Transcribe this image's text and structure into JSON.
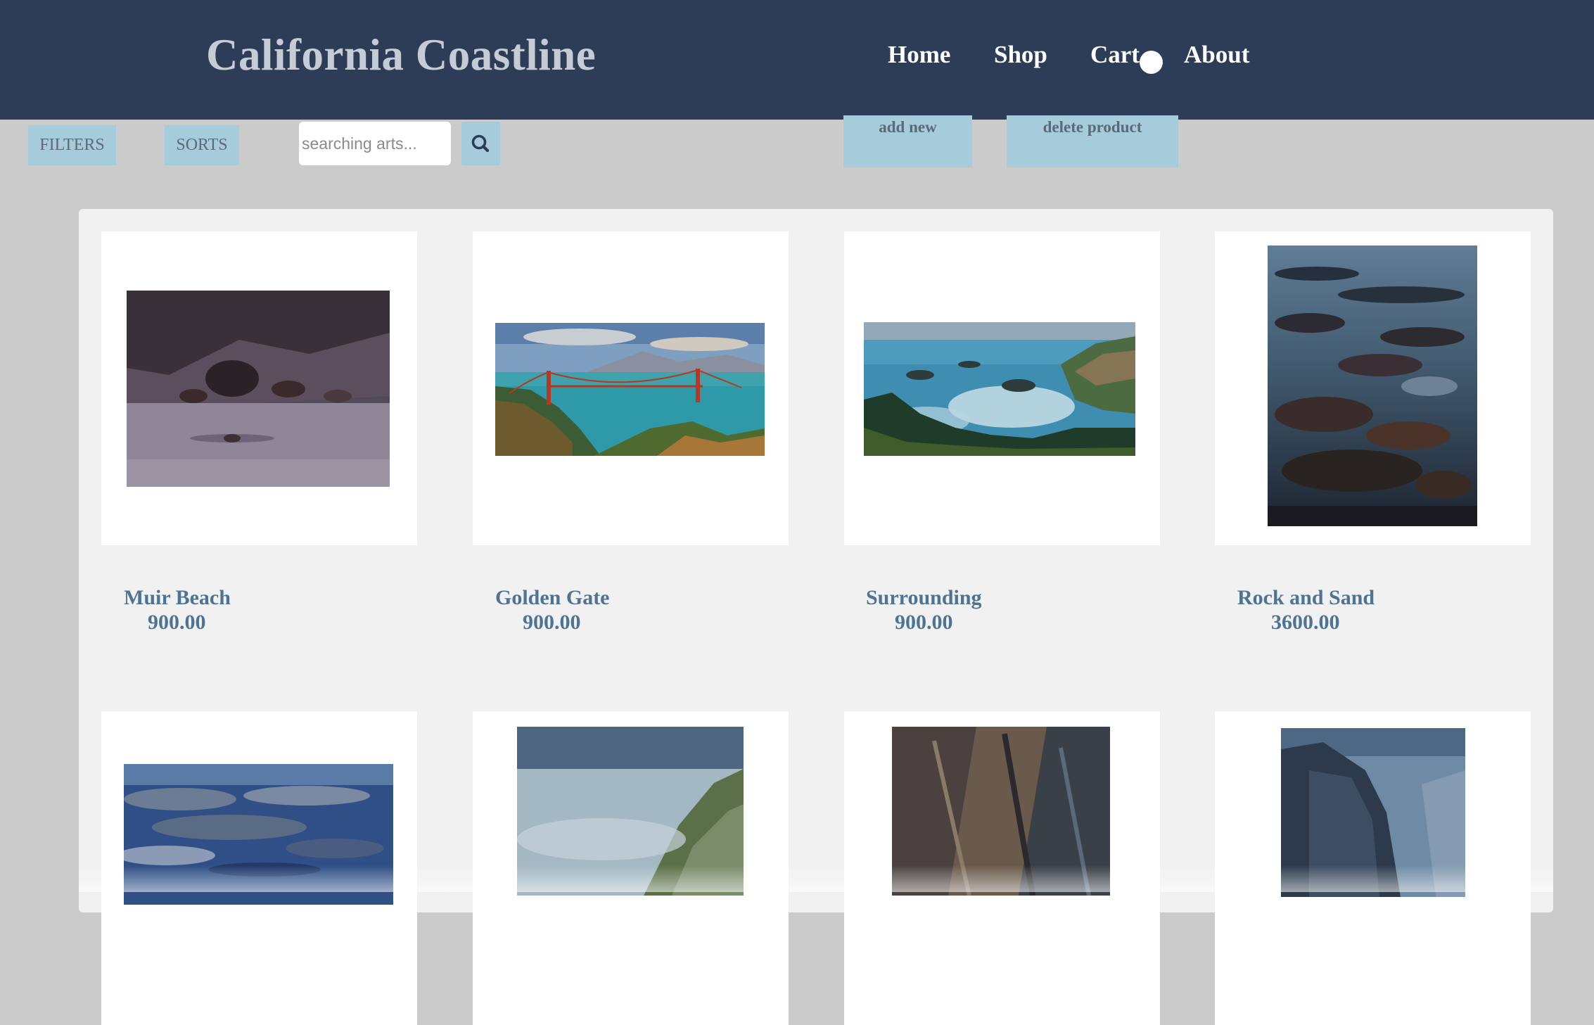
{
  "header": {
    "site_title": "California Coastline",
    "nav": {
      "home": "Home",
      "shop": "Shop",
      "cart": "Cart",
      "about": "About"
    }
  },
  "toolbar": {
    "filters_label": "FILTERS",
    "sorts_label": "SORTS",
    "search_placeholder": "searching arts...",
    "search_icon": "search-icon",
    "add_new_label": "add new",
    "delete_product_label": "delete product"
  },
  "products": [
    {
      "name": "Muir Beach",
      "price": "900.00"
    },
    {
      "name": "Golden Gate",
      "price": "900.00"
    },
    {
      "name": "Surrounding",
      "price": "900.00"
    },
    {
      "name": "Rock and Sand",
      "price": "3600.00"
    }
  ],
  "colors": {
    "header_bg": "#2e3d57",
    "page_bg": "#cbcbcb",
    "button_bg": "#a6cbdb",
    "product_text": "#4f7393"
  }
}
